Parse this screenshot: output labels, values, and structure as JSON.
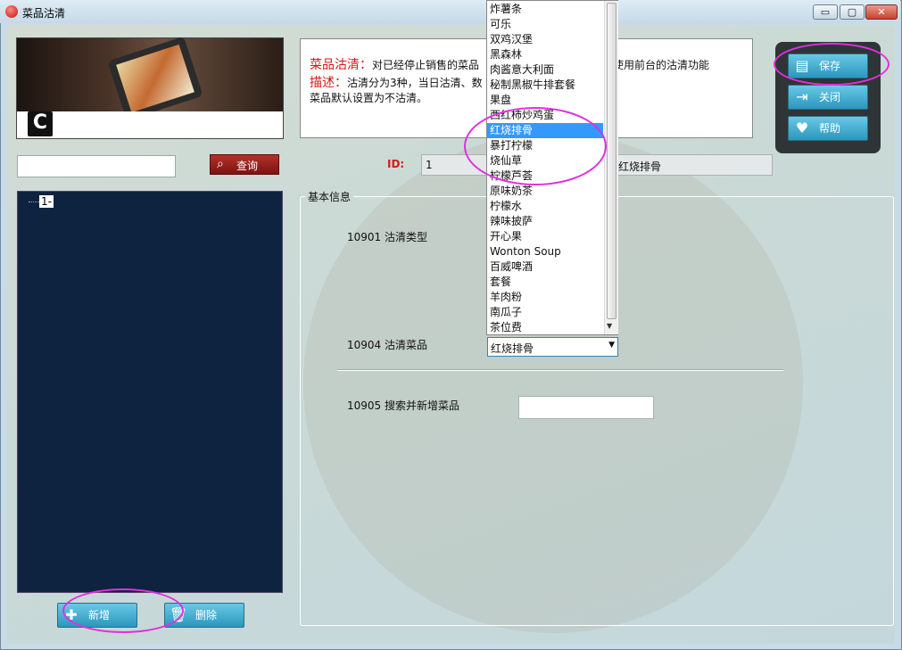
{
  "window": {
    "title": "菜品沽清",
    "minimize": "▭",
    "maximize": "▢",
    "close": "✕"
  },
  "description": {
    "title_label": "菜品沽清：",
    "title_text": "对已经停止销售的菜品",
    "title_text_tail": "使用前台的沽清功能",
    "desc_label": "描述：",
    "desc_text": "沽清分为3种，当日沽清、数",
    "desc_line2": "菜品默认设置为不沽清。"
  },
  "actions": {
    "save": "保存",
    "close": "关闭",
    "help": "帮助"
  },
  "search": {
    "value": "",
    "query_label": "查询"
  },
  "tree": {
    "root_label": "1-"
  },
  "bottom_buttons": {
    "add": "新增",
    "delete": "删除"
  },
  "record": {
    "id_label": "ID:",
    "id_value": "1",
    "name_value": "红烧排骨"
  },
  "basic_info": {
    "group_title": "基本信息",
    "field_type_label": "10901 沽清类型",
    "field_dish_label": "10904 沽清菜品",
    "field_dish_value": "红烧排骨",
    "field_search_add_label": "10905 搜索并新增菜品",
    "field_search_add_value": ""
  },
  "dropdown": {
    "selected_index": 8,
    "items": [
      "炸薯条",
      "可乐",
      "双鸡汉堡",
      "黑森林",
      "肉酱意大利面",
      "秘制黑椒牛排套餐",
      "果盘",
      "西红柿炒鸡蛋",
      "红烧排骨",
      "暴打柠檬",
      "烧仙草",
      "柠檬芦荟",
      "原味奶茶",
      "柠檬水",
      "辣味披萨",
      "开心果",
      "Wonton Soup",
      "百威啤酒",
      "套餐",
      "羊肉粉",
      "南瓜子",
      "茶位费"
    ]
  },
  "colors": {
    "annotation_ring": "#e22ee0",
    "selected_item": "#3399ff",
    "tree_background": "#0e2340",
    "button_blue": "#2b96bd",
    "query_red": "#b3322a"
  },
  "icons": [
    "app-icon",
    "magnifier-icon",
    "save-icon",
    "exit-icon",
    "heart-icon",
    "plus-icon",
    "trash-icon",
    "chevron-down-icon"
  ]
}
